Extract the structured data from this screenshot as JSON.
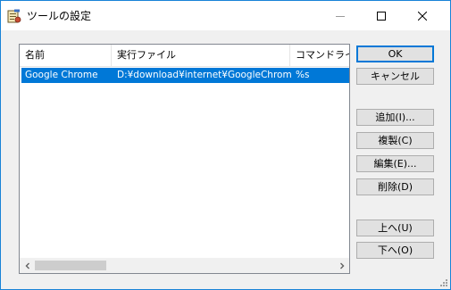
{
  "window": {
    "title": "ツールの設定",
    "icon": "tool-settings-icon",
    "accent_color": "#0078d7"
  },
  "list": {
    "columns": [
      "名前",
      "実行ファイル",
      "コマンドライン"
    ],
    "rows": [
      {
        "name": "Google Chrome",
        "executable": "D:¥download¥internet¥GoogleChrom...",
        "command_line": "%s",
        "selected": true
      }
    ]
  },
  "buttons": {
    "ok": "OK",
    "cancel": "キャンセル",
    "add": "追加(I)...",
    "duplicate": "複製(C)",
    "edit": "編集(E)...",
    "delete": "削除(D)",
    "move_up": "上へ(U)",
    "move_down": "下へ(O)"
  }
}
